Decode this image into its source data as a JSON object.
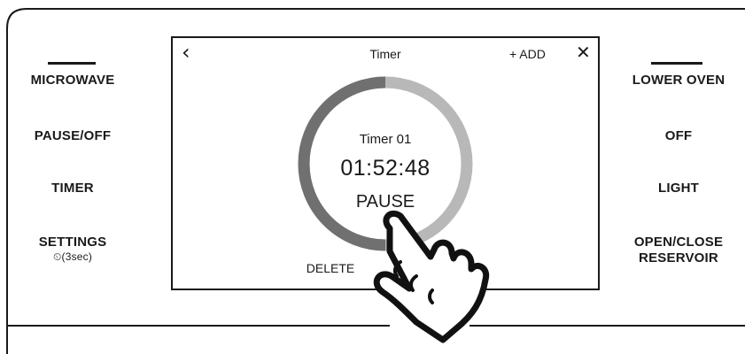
{
  "left_buttons": {
    "microwave": "MICROWAVE",
    "pause_off": "PAUSE/OFF",
    "timer": "TIMER",
    "settings": "SETTINGS",
    "settings_sub": "⏲(3sec)"
  },
  "right_buttons": {
    "lower_oven": "LOWER OVEN",
    "off": "OFF",
    "light": "LIGHT",
    "open_close_1": "OPEN/CLOSE",
    "open_close_2": "RESERVOIR"
  },
  "screen": {
    "back_icon": "‹",
    "title": "Timer",
    "add_label": "+ ADD",
    "close_icon": "✕",
    "timer_name": "Timer 01",
    "time": "01:52:48",
    "pause_label": "PAUSE",
    "delete_label": "DELETE",
    "progress_fraction": 0.5
  },
  "colors": {
    "ring_done": "#707070",
    "ring_remaining": "#b8b8b8",
    "line": "#1a1a1a"
  }
}
